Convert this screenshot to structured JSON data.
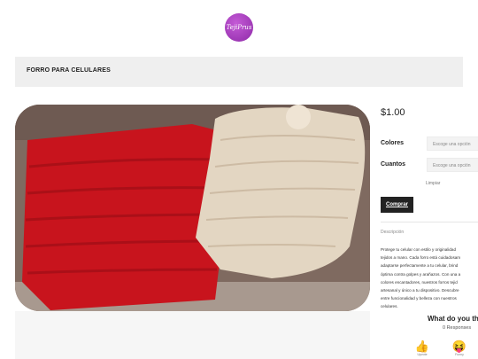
{
  "brand": {
    "logo_text": "TejiPrus"
  },
  "product": {
    "title": "FORRO PARA CELULARES",
    "price": "$1.00",
    "image_alt": "Forros tejidos para celular rojo y beige"
  },
  "options": [
    {
      "label": "Colores",
      "placeholder": "Escoge una opción"
    },
    {
      "label": "Cuantos",
      "placeholder": "Escoge una opción"
    }
  ],
  "clear_label": "Limpiar",
  "buy_label": "Comprar",
  "description": {
    "label": "Descripción",
    "text": "Protege tu celular con estilo y originalidad\ntejidos a mano. Cada forro está cuidadosam\nadaptarse perfectamente a tu celular, brind\nóptima contra golpes y arañazos. Con una a\ncolores encantadores, nuestros forros tejid\nartesanal y único a tu dispositivo. Descubre\nentre funcionalidad y belleza con nuestros\ncelulares."
  },
  "reactions": {
    "heading": "What do you th",
    "responses": "0 Responses",
    "items": [
      {
        "emoji": "👍",
        "label": "Upvote",
        "icon": "thumbs-up-icon"
      },
      {
        "emoji": "😝",
        "label": "Funny",
        "icon": "laughing-face-icon"
      }
    ]
  },
  "colors": {
    "accent_dark": "#222222",
    "title_bar_bg": "#efefef",
    "logo": "#a53dbd"
  }
}
